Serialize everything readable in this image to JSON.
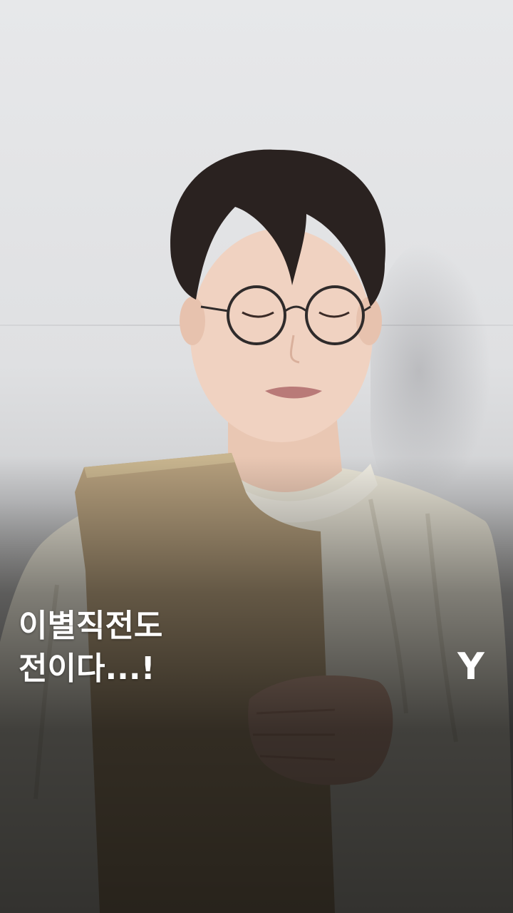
{
  "video": {
    "caption": "이별직전도\n전이다...!",
    "brand_mark": "Y"
  },
  "colors": {
    "wall": "#e2e3e5",
    "hair": "#2a2220",
    "sweater": "#e8e4d6",
    "cardboard": "#b59f7d",
    "caption_text": "#ffffff"
  }
}
